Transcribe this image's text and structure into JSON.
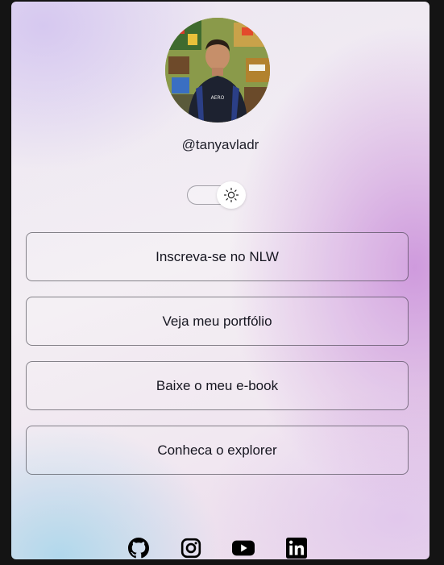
{
  "profile": {
    "username": "@tanyavladr",
    "avatar_icon": "profile-photo",
    "shirt_text": "AERO"
  },
  "theme_toggle": {
    "icon": "sun-icon",
    "state": "light"
  },
  "links": [
    {
      "label": "Inscreva-se no NLW"
    },
    {
      "label": "Veja meu portfólio"
    },
    {
      "label": "Baixe o meu e-book"
    },
    {
      "label": "Conheca o explorer"
    }
  ],
  "socials": [
    {
      "name": "github-icon"
    },
    {
      "name": "instagram-icon"
    },
    {
      "name": "youtube-icon"
    },
    {
      "name": "linkedin-icon"
    }
  ],
  "colors": {
    "page_background": "#141414",
    "text": "#161620",
    "button_border": "#38383f"
  }
}
